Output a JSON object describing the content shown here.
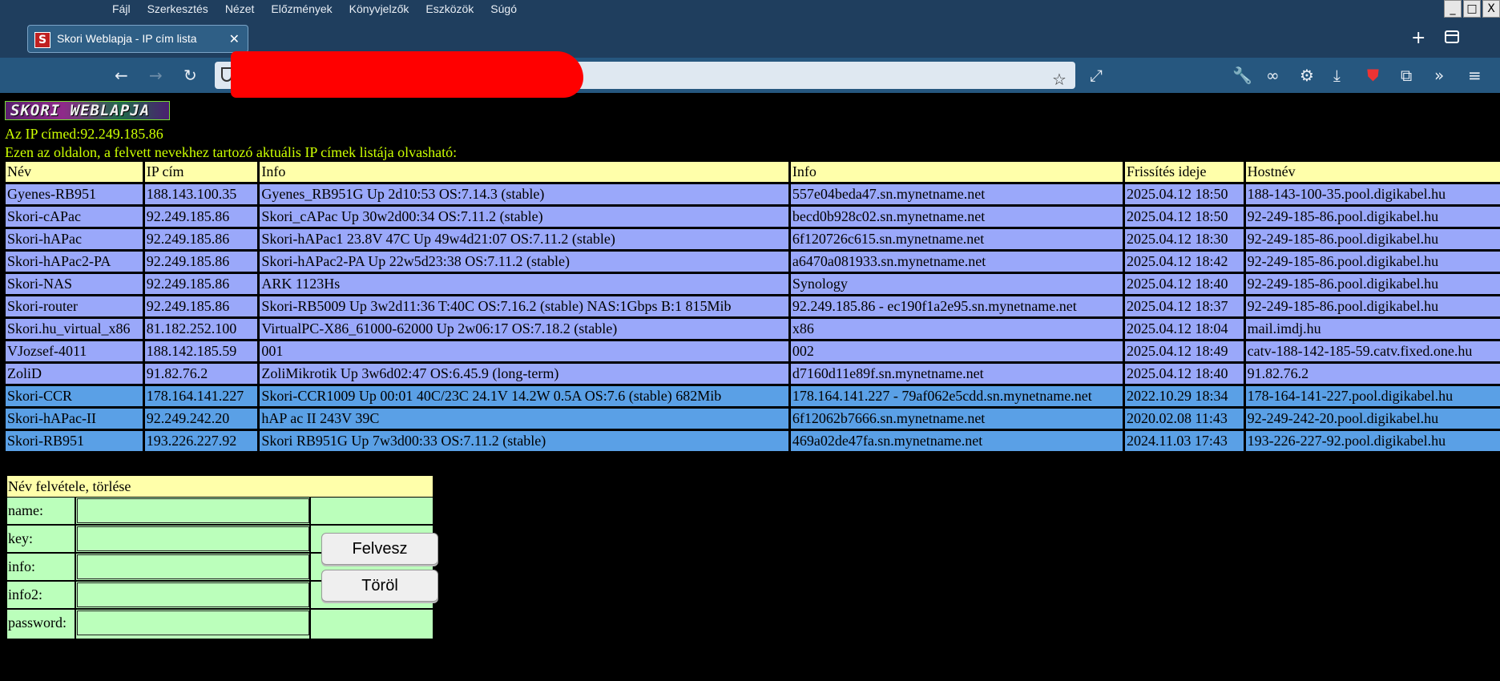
{
  "browser": {
    "menu": [
      "Fájl",
      "Szerkesztés",
      "Nézet",
      "Előzmények",
      "Könyvjelzők",
      "Eszközök",
      "Súgó"
    ],
    "window_controls": [
      "_",
      "□",
      "X"
    ],
    "tab": {
      "title": "Skori Weblapja - IP cím lista",
      "favicon": "S"
    },
    "new_tab_icon": "+",
    "url": ""
  },
  "page": {
    "logo_text": "SKORI WEBLAPJA",
    "ip_line": "Az IP címed:92.249.185.86",
    "description": "Ezen az oldalon, a felvett nevekhez tartozó aktuális IP címek listája olvasható:",
    "table": {
      "headers": [
        "Név",
        "IP cím",
        "Info",
        "Info",
        "Frissítés ideje",
        "Hostnév"
      ],
      "rows": [
        {
          "style": "a",
          "cells": [
            "Gyenes-RB951",
            "188.143.100.35",
            "Gyenes_RB951G Up 2d10:53 OS:7.14.3 (stable)",
            "557e04beda47.sn.mynetname.net",
            "2025.04.12 18:50",
            "188-143-100-35.pool.digikabel.hu"
          ]
        },
        {
          "style": "a",
          "cells": [
            "Skori-cAPac",
            "92.249.185.86",
            "Skori_cAPac Up 30w2d00:34 OS:7.11.2 (stable)",
            "becd0b928c02.sn.mynetname.net",
            "2025.04.12 18:50",
            "92-249-185-86.pool.digikabel.hu"
          ]
        },
        {
          "style": "a",
          "cells": [
            "Skori-hAPac",
            "92.249.185.86",
            "Skori-hAPac1 23.8V 47C Up 49w4d21:07 OS:7.11.2 (stable)",
            "6f120726c615.sn.mynetname.net",
            "2025.04.12 18:30",
            "92-249-185-86.pool.digikabel.hu"
          ]
        },
        {
          "style": "a",
          "cells": [
            "Skori-hAPac2-PA",
            "92.249.185.86",
            "Skori-hAPac2-PA Up 22w5d23:38 OS:7.11.2 (stable)",
            "a6470a081933.sn.mynetname.net",
            "2025.04.12 18:42",
            "92-249-185-86.pool.digikabel.hu"
          ]
        },
        {
          "style": "a",
          "cells": [
            "Skori-NAS",
            "92.249.185.86",
            "ARK 1123Hs",
            "Synology",
            "2025.04.12 18:40",
            "92-249-185-86.pool.digikabel.hu"
          ]
        },
        {
          "style": "a",
          "cells": [
            "Skori-router",
            "92.249.185.86",
            "Skori-RB5009 Up 3w2d11:36 T:40C OS:7.16.2 (stable) NAS:1Gbps B:1 815Mib",
            "92.249.185.86 - ec190f1a2e95.sn.mynetname.net",
            "2025.04.12 18:37",
            "92-249-185-86.pool.digikabel.hu"
          ]
        },
        {
          "style": "a",
          "cells": [
            "Skori.hu_virtual_x86",
            "81.182.252.100",
            "VirtualPC-X86_61000-62000 Up 2w06:17 OS:7.18.2 (stable)",
            "x86",
            "2025.04.12 18:04",
            "mail.imdj.hu"
          ]
        },
        {
          "style": "a",
          "cells": [
            "VJozsef-4011",
            "188.142.185.59",
            "001",
            "002",
            "2025.04.12 18:49",
            "catv-188-142-185-59.catv.fixed.one.hu"
          ]
        },
        {
          "style": "a",
          "cells": [
            "ZoliD",
            "91.82.76.2",
            "ZoliMikrotik Up 3w6d02:47 OS:6.45.9 (long-term)",
            "d7160d11e89f.sn.mynetname.net",
            "2025.04.12 18:40",
            "91.82.76.2"
          ]
        },
        {
          "style": "b",
          "cells": [
            "Skori-CCR",
            "178.164.141.227",
            "Skori-CCR1009 Up 00:01 40C/23C 24.1V 14.2W 0.5A OS:7.6 (stable) 682Mib",
            "178.164.141.227 - 79af062e5cdd.sn.mynetname.net",
            "2022.10.29 18:34",
            "178-164-141-227.pool.digikabel.hu"
          ]
        },
        {
          "style": "b",
          "cells": [
            "Skori-hAPac-II",
            "92.249.242.20",
            "hAP ac II 243V 39C",
            "6f12062b7666.sn.mynetname.net",
            "2020.02.08 11:43",
            "92-249-242-20.pool.digikabel.hu"
          ]
        },
        {
          "style": "b",
          "cells": [
            "Skori-RB951",
            "193.226.227.92",
            "Skori RB951G Up 7w3d00:33 OS:7.11.2 (stable)",
            "469a02de47fa.sn.mynetname.net",
            "2024.11.03 17:43",
            "193-226-227-92.pool.digikabel.hu"
          ]
        }
      ]
    },
    "form": {
      "title": "Név felvétele, törlése",
      "labels": [
        "name:",
        "key:",
        "info:",
        "info2:",
        "password:"
      ],
      "values": [
        "",
        "",
        "",
        "",
        ""
      ],
      "add_button": "Felvesz",
      "delete_button": "Töröl"
    }
  }
}
